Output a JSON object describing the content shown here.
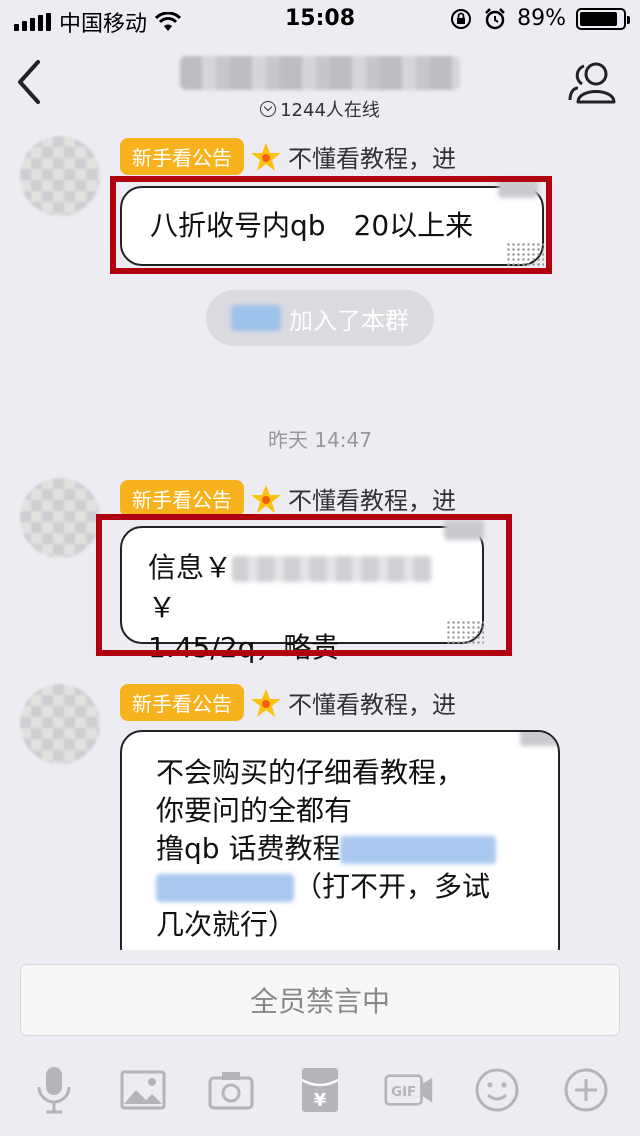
{
  "status_bar": {
    "carrier": "中国移动",
    "time": "15:08",
    "battery_percent": "89%",
    "battery_level": 0.89,
    "icons": [
      "signal-icon",
      "wifi-icon",
      "rotation-lock-icon",
      "alarm-icon",
      "battery-icon"
    ]
  },
  "header": {
    "back_icon": "back-arrow-icon",
    "online_count": "1244人在线",
    "group_members_icon": "group-members-icon"
  },
  "messages": [
    {
      "tag": "新手看公告",
      "sender": "不懂看教程，进",
      "lines": [
        "八折收号内qb　20以上来"
      ]
    },
    {
      "system_suffix": "加入了本群"
    },
    {
      "tag": "新手看公告",
      "sender": "不懂看教程，进",
      "line1_prefix": "信息￥",
      "line1_suffix": "￥",
      "line2": "1.45/2q，略贵"
    },
    {
      "tag": "新手看公告",
      "sender": "不懂看教程，进",
      "line1": "不会购买的仔细看教程，",
      "line2": "你要问的全都有",
      "line3_prefix": "撸qb  话费教程",
      "line4_suffix": "（打不开，多试",
      "line5": "几次就行）"
    }
  ],
  "timestamp": "昨天 14:47",
  "input": {
    "placeholder": "全员禁言中"
  },
  "toolbar": {
    "gif_label": "GIF",
    "yen_label": "¥",
    "icons": [
      "microphone-icon",
      "image-icon",
      "camera-icon",
      "red-packet-icon",
      "gif-icon",
      "emoji-icon",
      "plus-icon"
    ]
  }
}
